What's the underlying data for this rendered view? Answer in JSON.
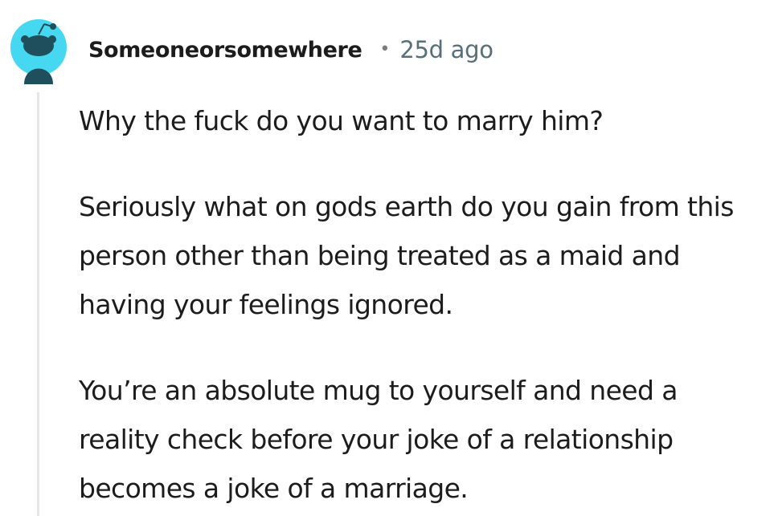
{
  "comment": {
    "author": "Someoneorsomewhere",
    "separator": "•",
    "timestamp": "25d ago",
    "paragraphs": [
      "Why the fuck do you want to marry him?",
      "Seriously what on gods earth do you gain from this person other than being treated as a maid and having your feelings ignored.",
      "You’re an absolute mug to yourself and need a reality check before your joke of a relationship becomes a joke of a marriage."
    ]
  },
  "colors": {
    "avatar_bg": "#46d8f0",
    "avatar_figure": "#1f4f5c",
    "thread_line": "#e4e6e8",
    "text": "#1c1c1c",
    "meta": "#576f76"
  },
  "icons": {
    "avatar": "snoo-avatar-icon"
  }
}
